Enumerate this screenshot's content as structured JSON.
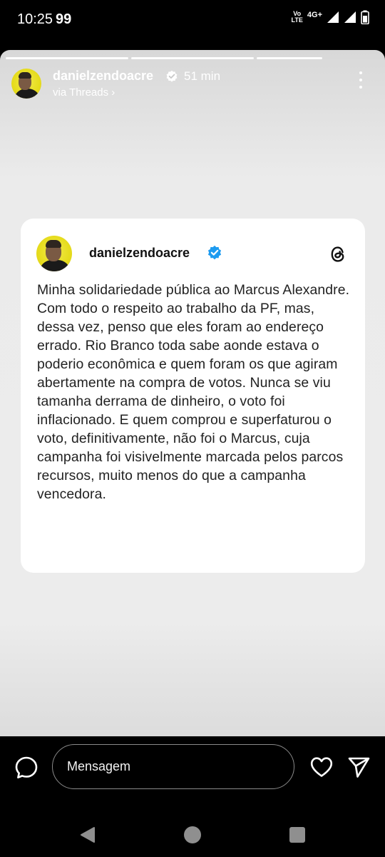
{
  "status_bar": {
    "time": "10:25",
    "badge": "99",
    "volte_label_top": "Vo",
    "volte_label_bottom": "LTE",
    "network": "4G+"
  },
  "story": {
    "progress_segments": 3,
    "active_segment": 2,
    "username": "danielzendoacre",
    "verified": true,
    "time_ago": "51 min",
    "source_label": "via Threads ›",
    "more_icon": "more-vertical-icon"
  },
  "threads_card": {
    "username": "danielzendoacre",
    "verified": true,
    "brand_icon": "threads-logo-icon",
    "post_text": "Minha solidariedade pública ao Marcus Alexandre. Com todo o respeito ao trabalho da PF, mas, dessa vez, penso que eles foram ao endereço errado. Rio Branco toda sabe aonde estava o poderio econômica e quem foram os que agiram abertamente na compra de votos. Nunca se viu tamanha derrama de dinheiro, o voto foi inflacionado. E quem comprou e superfaturou o voto, definitivamente, não foi o Marcus, cuja campanha foi visivelmente marcada pelos parcos recursos, muito menos do que a campanha vencedora."
  },
  "message_bar": {
    "placeholder": "Mensagem",
    "value": "",
    "chat_icon": "chat-bubble-icon",
    "like_icon": "heart-icon",
    "share_icon": "send-icon"
  },
  "colors": {
    "background": "#000000",
    "card": "#ffffff",
    "verified_blue": "#1d9bf0",
    "story_background": "#ebebeb"
  }
}
